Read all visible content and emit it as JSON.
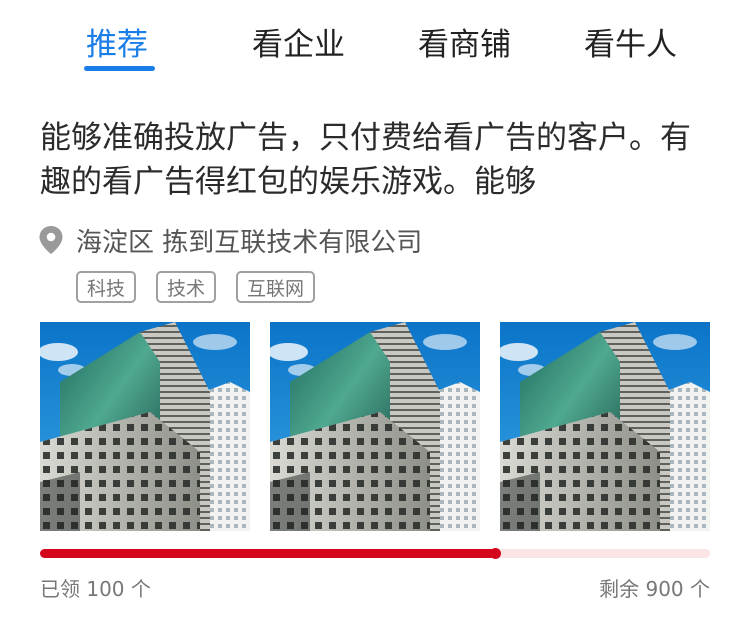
{
  "tabs": [
    {
      "label": "推荐",
      "active": true
    },
    {
      "label": "看企业",
      "active": false
    },
    {
      "label": "看商铺",
      "active": false
    },
    {
      "label": "看牛人",
      "active": false
    }
  ],
  "card": {
    "title": "能够准确投放广告，只付费给看广告的客户。有趣的看广告得红包的娱乐游戏。能够",
    "location": "海淀区 拣到互联技术有限公司",
    "tags": [
      "科技",
      "技术",
      "互联网"
    ]
  },
  "progress": {
    "claimed_label": "已领 100 个",
    "remaining_label": "剩余 900 个",
    "claimed": 100,
    "remaining": 900
  },
  "colors": {
    "accent_blue": "#1a7ee8",
    "progress_red": "#d4061c",
    "progress_track": "#fbe4e6"
  },
  "icons": {
    "location": "map-pin-icon"
  }
}
